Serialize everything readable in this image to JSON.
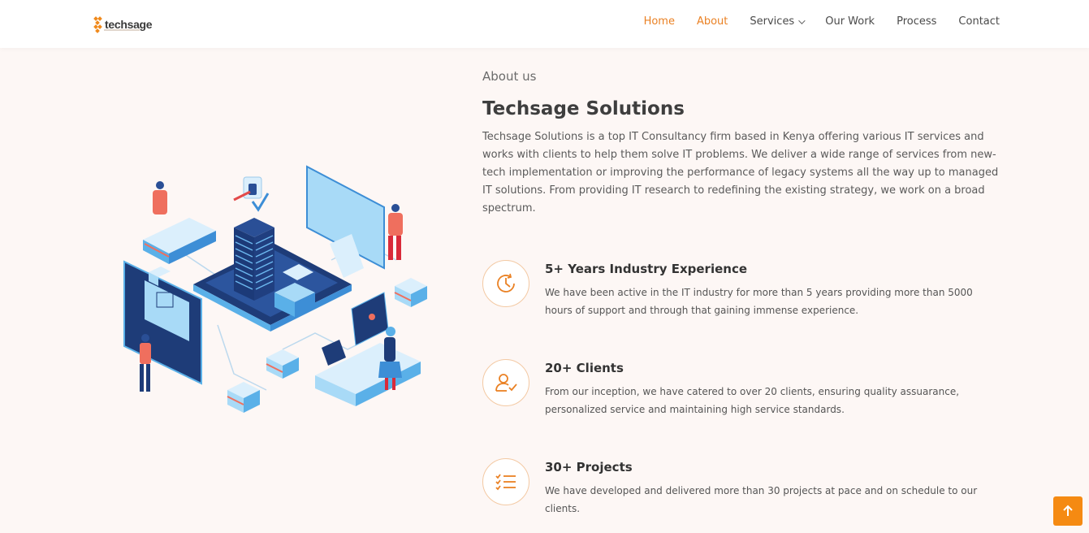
{
  "brand": {
    "name": "techsage",
    "accent": "#ea8124"
  },
  "nav": {
    "items": [
      {
        "label": "Home"
      },
      {
        "label": "About"
      },
      {
        "label": "Services"
      },
      {
        "label": "Our Work"
      },
      {
        "label": "Process"
      },
      {
        "label": "Contact"
      }
    ]
  },
  "about": {
    "eyebrow": "About us",
    "title": "Techsage Solutions",
    "description": "Techsage Solutions is a top IT Consultancy firm based in Kenya offering various IT services and works with clients to help them solve IT problems. We deliver a wide range of services from new-tech implementation or improving the performance of legacy systems all the way up to managed IT solutions. From providing IT research to redefining the existing strategy, we work on a broad spectrum."
  },
  "features": [
    {
      "icon": "clock-icon",
      "title": "5+ Years Industry Experience",
      "text": "We have been active in the IT industry for more than 5 years providing more than 5000 hours of support and through that gaining immense experience."
    },
    {
      "icon": "user-check-icon",
      "title": "20+ Clients",
      "text": "From our inception, we have catered to over 20 clients, ensuring quality assuarance, personalized service and maintaining high service standards."
    },
    {
      "icon": "list-check-icon",
      "title": "30+ Projects",
      "text": "We have developed and delivered more than 30 projects at pace and on schedule to our clients."
    }
  ],
  "scroll_top": {
    "icon": "arrow-up-icon"
  }
}
